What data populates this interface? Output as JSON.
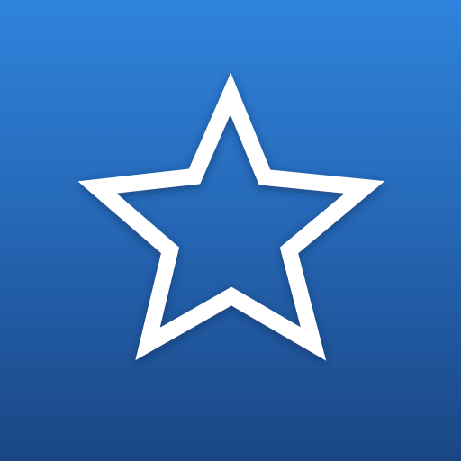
{
  "icon": {
    "name": "star-outline-icon",
    "gradient_top": "#2f83dc",
    "gradient_mid": "#2566b4",
    "gradient_bottom": "#1a4684",
    "stroke_color": "#ffffff"
  }
}
